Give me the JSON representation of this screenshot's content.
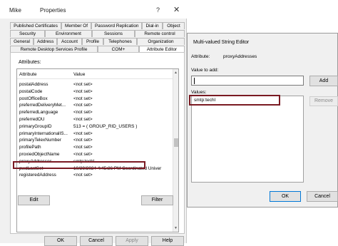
{
  "properties": {
    "user": "Mike",
    "title": "Properties",
    "help": "?",
    "close": "✕",
    "tabs_row1": [
      "Published Certificates",
      "Member Of",
      "Password Replication",
      "Dial-in",
      "Object"
    ],
    "tabs_row2": [
      "Security",
      "Environment",
      "Sessions",
      "Remote control"
    ],
    "tabs_row3": [
      "General",
      "Address",
      "Account",
      "Profile",
      "Telephones",
      "Organization"
    ],
    "tabs_row4": [
      "Remote Desktop Services Profile",
      "COM+",
      "Attribute Editor"
    ],
    "attributes_label": "Attributes:",
    "columns": [
      "Attribute",
      "Value"
    ],
    "rows": [
      {
        "attr": "postalAddress",
        "val": "<not set>"
      },
      {
        "attr": "postalCode",
        "val": "<not set>"
      },
      {
        "attr": "postOfficeBox",
        "val": "<not set>"
      },
      {
        "attr": "preferredDeliveryMet...",
        "val": "<not set>"
      },
      {
        "attr": "preferredLanguage",
        "val": "<not set>"
      },
      {
        "attr": "preferredOU",
        "val": "<not set>"
      },
      {
        "attr": "primaryGroupID",
        "val": "513 = ( GROUP_RID_USERS )"
      },
      {
        "attr": "primaryInternationalIS...",
        "val": "<not set>"
      },
      {
        "attr": "primaryTelexNumber",
        "val": "<not set>"
      },
      {
        "attr": "profilePath",
        "val": "<not set>"
      },
      {
        "attr": "proxiedObjectName",
        "val": "<not set>"
      },
      {
        "attr": "proxyAddresses",
        "val": "smtp:techl"
      },
      {
        "attr": "pwdLastSet",
        "val": "10/29/2024 4:45:36 PM Coordinated Univer"
      },
      {
        "attr": "registeredAddress",
        "val": "<not set>"
      }
    ],
    "edit_label": "Edit",
    "filter_label": "Filter",
    "ok_label": "OK",
    "cancel_label": "Cancel",
    "apply_label": "Apply",
    "helpbtn_label": "Help"
  },
  "editor": {
    "title": "Multi-valued String Editor",
    "attribute_label": "Attribute:",
    "attribute_value": "proxyAddresses",
    "value_to_add_label": "Value to add:",
    "value_to_add": "",
    "add_label": "Add",
    "values_label": "Values:",
    "values": [
      "smtp:techl"
    ],
    "remove_label": "Remove",
    "ok_label": "OK",
    "cancel_label": "Cancel"
  },
  "colors": {
    "highlight_border": "#7a1a22",
    "ok_border": "#0078d7"
  }
}
